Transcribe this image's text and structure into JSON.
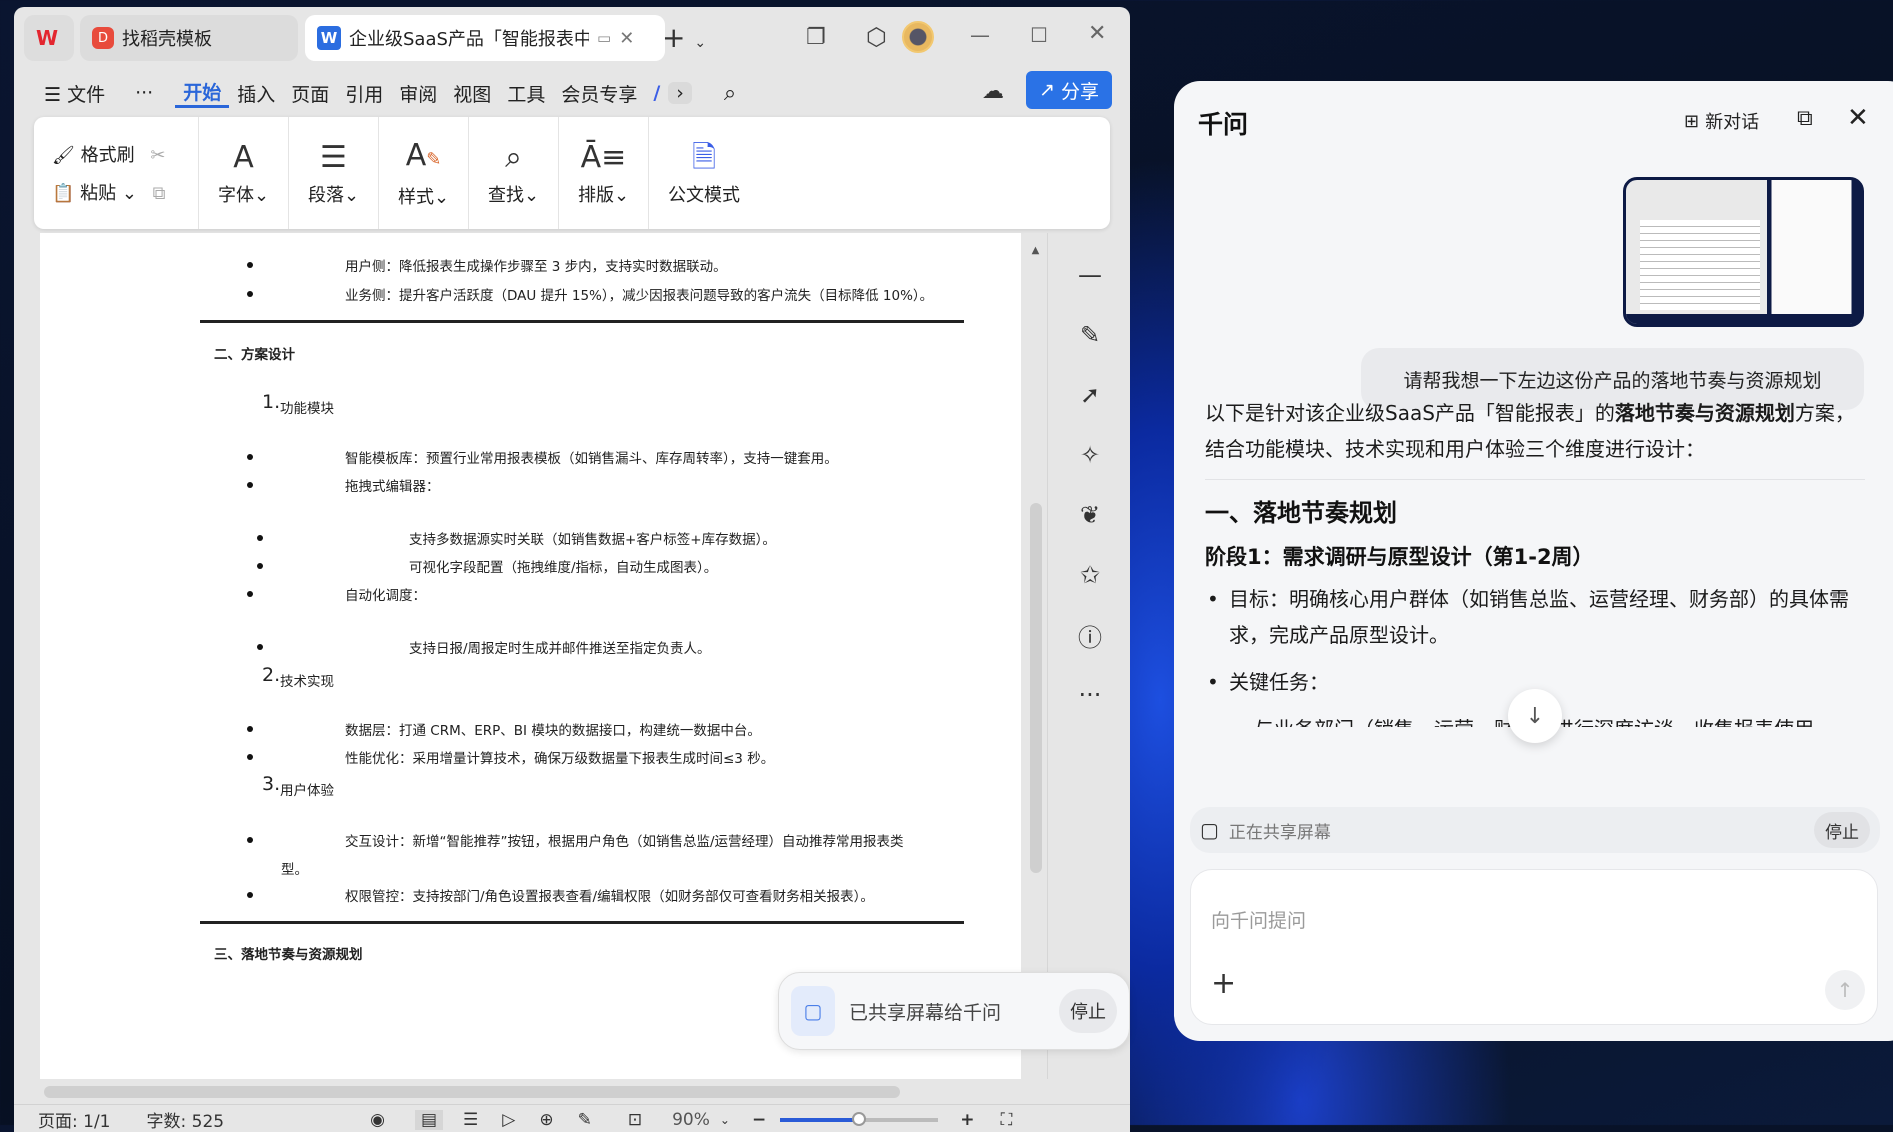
{
  "wps": {
    "tabs": [
      {
        "label": "找稻壳模板"
      },
      {
        "label": "企业级SaaS产品「智能报表中"
      }
    ],
    "menu": [
      "文件",
      "···",
      "开始",
      "插入",
      "页面",
      "引用",
      "审阅",
      "视图",
      "工具",
      "会员专享"
    ],
    "active_menu": "开始",
    "share_label": "分享",
    "ribbon": {
      "format_painter": "格式刷",
      "paste": "粘贴",
      "font": "字体",
      "paragraph": "段落",
      "style": "样式",
      "find": "查找",
      "layout": "排版",
      "official": "公文模式"
    },
    "status": {
      "page": "页面: 1/1",
      "words": "字数: 525",
      "zoom": "90%"
    },
    "zoom_level": 0.5,
    "share_float": {
      "text": "已共享屏幕给千问",
      "stop": "停止"
    }
  },
  "document": {
    "lines": [
      "用户侧：降低报表生成操作步骤至 3 步内，支持实时数据联动。",
      "业务侧：提升客户活跃度（DAU 提升 15%），减少因报表问题导致的客户流失（目标降低 10%）。",
      "二、方案设计",
      "1.",
      "功能模块",
      "智能模板库：预置行业常用报表模板（如销售漏斗、库存周转率），支持一键套用。",
      "拖拽式编辑器：",
      "支持多数据源实时关联（如销售数据+客户标签+库存数据）。",
      "可视化字段配置（拖拽维度/指标，自动生成图表）。",
      "自动化调度：",
      "支持日报/周报定时生成并邮件推送至指定负责人。",
      "2.",
      "技术实现",
      "数据层：打通 CRM、ERP、BI 模块的数据接口，构建统一数据中台。",
      "性能优化：采用增量计算技术，确保万级数据量下报表生成时间≤3 秒。",
      "3.",
      "用户体验",
      "交互设计：新增“智能推荐”按钮，根据用户角色（如销售总监/运营经理）自动推荐常用报表类",
      "型。",
      "权限管控：支持按部门/角色设置报表查看/编辑权限（如财务部仅可查看财务相关报表）。",
      "三、落地节奏与资源规划"
    ]
  },
  "qianwen": {
    "title": "千问",
    "new_chat": "新对话",
    "user_message": "请帮我想一下左边这份产品的落地节奏与资源规划",
    "reply": {
      "intro_a": "以下是针对该企业级SaaS产品「智能报表」的",
      "intro_bold": "落地节奏与资源规划",
      "intro_b": "方案，结合功能模块、技术实现和用户体验三个维度进行设计：",
      "h1": "一、落地节奏规划",
      "h2": "阶段1：需求调研与原型设计（第1-2周）",
      "bullet1": "目标：明确核心用户群体（如销售总监、运营经理、财务部）的具体需求，完成产品原型设计。",
      "bullet2": "关键任务：",
      "partial": "与业务部门（销售、运营、财务）进行深度访谈，收集报表使用"
    },
    "sharing_text": "正在共享屏幕",
    "stop": "停止",
    "input_placeholder": "向千问提问"
  }
}
